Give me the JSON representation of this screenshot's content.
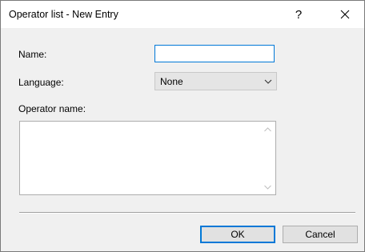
{
  "window": {
    "title": "Operator list - New Entry",
    "help_label": "?",
    "close_icon": "close-icon"
  },
  "form": {
    "name_label": "Name:",
    "name_value": "",
    "language_label": "Language:",
    "language_value": "None",
    "operator_name_label": "Operator name:",
    "operator_name_value": ""
  },
  "buttons": {
    "ok_label": "OK",
    "cancel_label": "Cancel"
  },
  "colors": {
    "focus_accent": "#0078d7",
    "dialog_background": "#f0f0f0"
  }
}
